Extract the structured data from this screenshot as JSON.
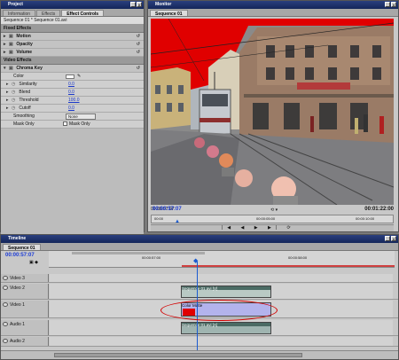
{
  "effect_controls": {
    "window_title": "Project",
    "tabs": [
      "Information",
      "Effects",
      "Effect Controls"
    ],
    "sequence_line": "Sequence 01 * Sequence 01.avi",
    "fixed_effects_label": "Fixed Effects",
    "fixed_effects": [
      "Motion",
      "Opacity",
      "Volume"
    ],
    "video_effects_label": "Video Effects",
    "chroma_key": {
      "name": "Chroma Key",
      "params": [
        {
          "label": "Color",
          "kind": "color",
          "color": "#ffffff"
        },
        {
          "label": "Similarity",
          "value": "0.0"
        },
        {
          "label": "Blend",
          "value": "0.0"
        },
        {
          "label": "Threshold",
          "value": "100.0"
        },
        {
          "label": "Cutoff",
          "value": "0.0"
        },
        {
          "label": "Smoothing",
          "kind": "select",
          "value": "None"
        },
        {
          "label": "Mask Only",
          "kind": "checkbox",
          "checkbox_label": "Mask Only"
        }
      ]
    }
  },
  "monitor": {
    "window_title": "Monitor",
    "tab": "Sequence 01",
    "current_timecode": "00:00:57:07",
    "duration_timecode": "00:01:22:00",
    "ruler_labels": [
      "00:00",
      "00:00:05:00",
      "00:00:10:00"
    ]
  },
  "timeline": {
    "window_title": "Timeline",
    "tab": "Sequence 01",
    "current_timecode": "00:00:57:07",
    "ruler_labels": [
      "00:00:57:00",
      "00:00:58:00"
    ],
    "tracks": [
      {
        "name": "Video 3",
        "type": "video"
      },
      {
        "name": "Video 2",
        "type": "video",
        "clip": "Sequence 01.avi [V]"
      },
      {
        "name": "Video 1",
        "type": "video",
        "clip": "Color Matte"
      },
      {
        "name": "Audio 1",
        "type": "audio",
        "clip": "Sequence 01.avi [A]"
      },
      {
        "name": "Audio 2",
        "type": "audio"
      }
    ]
  },
  "colors": {
    "timecode_blue": "#1b3bd6",
    "title_bar": "#2a3f7e",
    "chroma_red": "#e00000",
    "highlight_ellipse": "#d40000"
  }
}
